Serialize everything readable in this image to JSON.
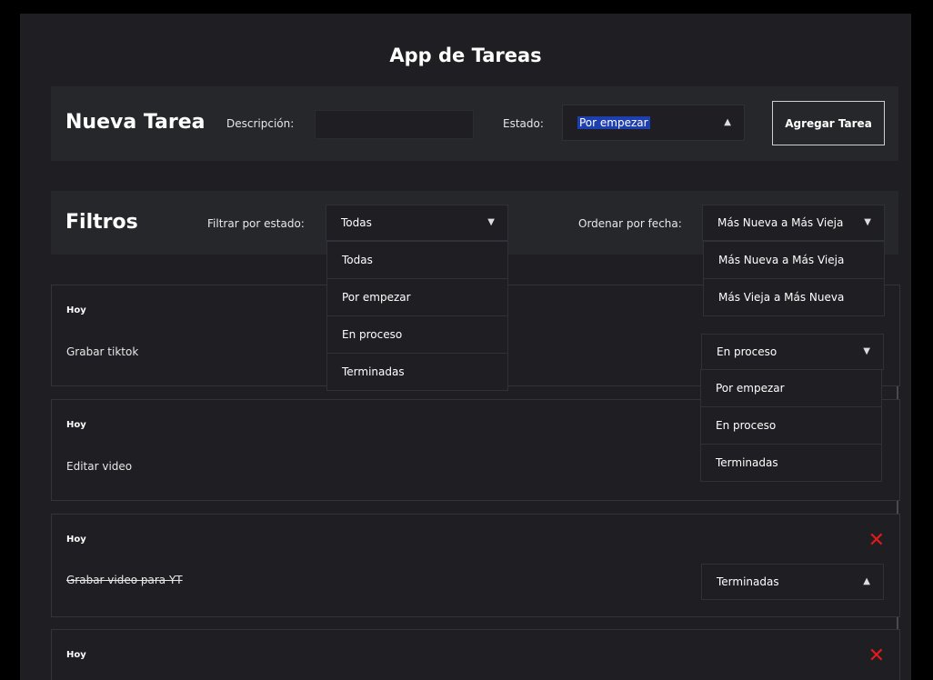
{
  "app": {
    "title": "App de Tareas"
  },
  "new_task": {
    "heading": "Nueva Tarea",
    "description_label": "Descripción:",
    "description_value": "",
    "status_label": "Estado:",
    "status_value": "Por empezar",
    "add_button": "Agregar Tarea"
  },
  "filters": {
    "heading": "Filtros",
    "status_filter_label": "Filtrar por estado:",
    "status_filter_value": "Todas",
    "status_filter_options": [
      "Todas",
      "Por empezar",
      "En proceso",
      "Terminadas"
    ],
    "sort_label": "Ordenar por fecha:",
    "sort_value": "Más Nueva a Más Vieja",
    "sort_options": [
      "Más Nueva a Más Vieja",
      "Más Vieja a Más Nueva"
    ]
  },
  "tasks": [
    {
      "date": "Hoy",
      "description": "Grabar tiktok",
      "status": "En proceso",
      "completed": false
    },
    {
      "date": "Hoy",
      "description": "Editar video",
      "status": "",
      "completed": false
    },
    {
      "date": "Hoy",
      "description": "Grabar video para YT",
      "status": "Terminadas",
      "completed": true
    },
    {
      "date": "Hoy",
      "description": "",
      "status": "",
      "completed": false
    }
  ],
  "task_status_options": [
    "Por empezar",
    "En proceso",
    "Terminadas"
  ],
  "icons": {
    "delete": "close-icon",
    "chevron_down": "chevron-down-icon",
    "chevron_up": "chevron-up-icon"
  },
  "colors": {
    "background": "#1f1f23",
    "panel": "#26272b",
    "delete": "#e01b1b",
    "highlight": "#1e3fae"
  }
}
